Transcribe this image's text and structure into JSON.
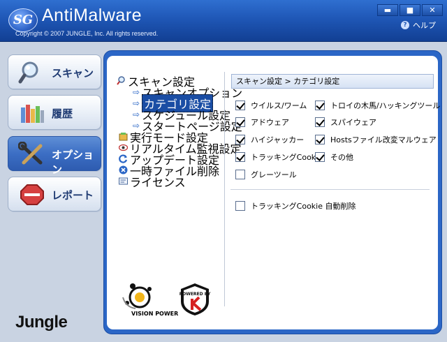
{
  "window": {
    "logo": "SG",
    "title": "AntiMalware",
    "copyright": "Copyright © 2007 JUNGLE, Inc. All rights reserved.",
    "help_label": "ヘルプ",
    "minimize_label": "▬",
    "maximize_label": "■",
    "close_label": "✕"
  },
  "nav": {
    "items": [
      {
        "label": "スキャン",
        "icon": "magnifier-icon"
      },
      {
        "label": "履歴",
        "icon": "history-books-icon"
      },
      {
        "label": "オプション",
        "icon": "tools-icon"
      },
      {
        "label": "レポート",
        "icon": "stop-sign-icon"
      }
    ],
    "active_index": 2,
    "brand": "Jungle"
  },
  "tree": {
    "items": [
      {
        "label": "スキャン設定",
        "level": 0,
        "icon": "scan-settings-icon"
      },
      {
        "label": "スキャンオプション",
        "level": 1
      },
      {
        "label": "カテゴリ設定",
        "level": 1,
        "selected": true
      },
      {
        "label": "スケジュール設定",
        "level": 1
      },
      {
        "label": "スタートページ設定",
        "level": 1
      },
      {
        "label": "実行モード設定",
        "level": 0,
        "icon": "run-mode-icon"
      },
      {
        "label": "リアルタイム監視設定",
        "level": 0,
        "icon": "eye-icon"
      },
      {
        "label": "アップデート設定",
        "level": 0,
        "icon": "update-icon"
      },
      {
        "label": "一時ファイル削除",
        "level": 0,
        "icon": "delete-icon"
      },
      {
        "label": "ライセンス",
        "level": 0,
        "icon": "license-icon"
      }
    ]
  },
  "content": {
    "breadcrumb": "スキャン設定 > カテゴリ設定",
    "categories": [
      {
        "label": "ウイルス/ワーム",
        "checked": true
      },
      {
        "label": "トロイの木馬/ハッキングツール",
        "checked": true
      },
      {
        "label": "アドウェア",
        "checked": true
      },
      {
        "label": "スパイウェア",
        "checked": true
      },
      {
        "label": "ハイジャッカー",
        "checked": true
      },
      {
        "label": "Hostsファイル改変マルウェア",
        "checked": true
      },
      {
        "label": "トラッキングCookie",
        "checked": true
      },
      {
        "label": "その他",
        "checked": true
      },
      {
        "label": "グレーツール",
        "checked": false
      }
    ],
    "auto_delete": {
      "label": "トラッキングCookie 自動削除",
      "checked": false
    }
  },
  "logos": {
    "vision_power": "VISION POWER",
    "kaspersky_text": "POWERED BY"
  },
  "colors": {
    "accent": "#2b66c6",
    "titlebar": "#1f57b6"
  }
}
